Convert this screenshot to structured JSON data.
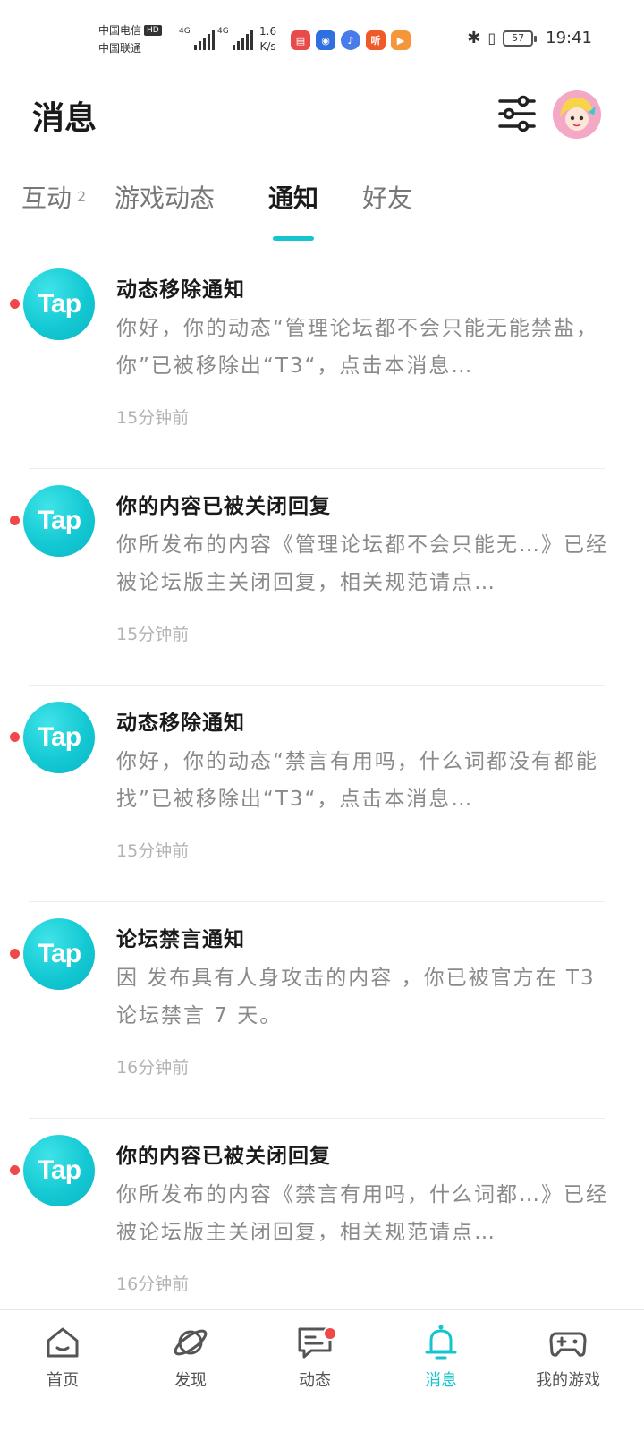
{
  "status_bar": {
    "carrier_1": "中国电信",
    "carrier_hd": "HD",
    "carrier_2": "中国联通",
    "net_1": "4G",
    "net_2": "4G",
    "speed_value": "1.6",
    "speed_unit": "K/s",
    "app_icons": [
      "book-app-icon",
      "bulb-app-icon",
      "music-app-icon",
      "listen-app-icon",
      "video-app-icon"
    ],
    "listen_char": "听",
    "more": "···",
    "battery": "57",
    "time": "19:41"
  },
  "header": {
    "title": "消息"
  },
  "tabs": [
    {
      "label": "互动",
      "count": "2"
    },
    {
      "label": "游戏动态"
    },
    {
      "label": "通知",
      "active": true
    },
    {
      "label": "好友"
    }
  ],
  "notifications": [
    {
      "logo": "Tap",
      "title": "动态移除通知",
      "body": "你好，你的动态“管理论坛都不会只能无能禁盐，你”已被移除出“T3“，点击本消息…",
      "time": "15分钟前",
      "unread": true
    },
    {
      "logo": "Tap",
      "title": "你的内容已被关闭回复",
      "body": "你所发布的内容《管理论坛都不会只能无…》已经被论坛版主关闭回复，相关规范请点…",
      "time": "15分钟前",
      "unread": true
    },
    {
      "logo": "Tap",
      "title": "动态移除通知",
      "body": "你好，你的动态“禁言有用吗，什么词都没有都能找”已被移除出“T3“，点击本消息…",
      "time": "15分钟前",
      "unread": true
    },
    {
      "logo": "Tap",
      "title": "论坛禁言通知",
      "body": "因 发布具有人身攻击的内容 ，你已被官方在 T3 论坛禁言 7 天。",
      "time": "16分钟前",
      "unread": true
    },
    {
      "logo": "Tap",
      "title": "你的内容已被关闭回复",
      "body": "你所发布的内容《禁言有用吗，什么词都…》已经被论坛版主关闭回复，相关规范请点…",
      "time": "16分钟前",
      "unread": true
    }
  ],
  "bottom_nav": [
    {
      "label": "首页",
      "icon": "home-icon"
    },
    {
      "label": "发现",
      "icon": "planet-icon"
    },
    {
      "label": "动态",
      "icon": "chat-icon",
      "badge": true
    },
    {
      "label": "消息",
      "icon": "bell-icon",
      "active": true
    },
    {
      "label": "我的游戏",
      "icon": "gamepad-icon"
    }
  ],
  "colors": {
    "accent": "#15c5ce",
    "unread_dot": "#f04848",
    "tap_logo": "#14c9d3"
  }
}
